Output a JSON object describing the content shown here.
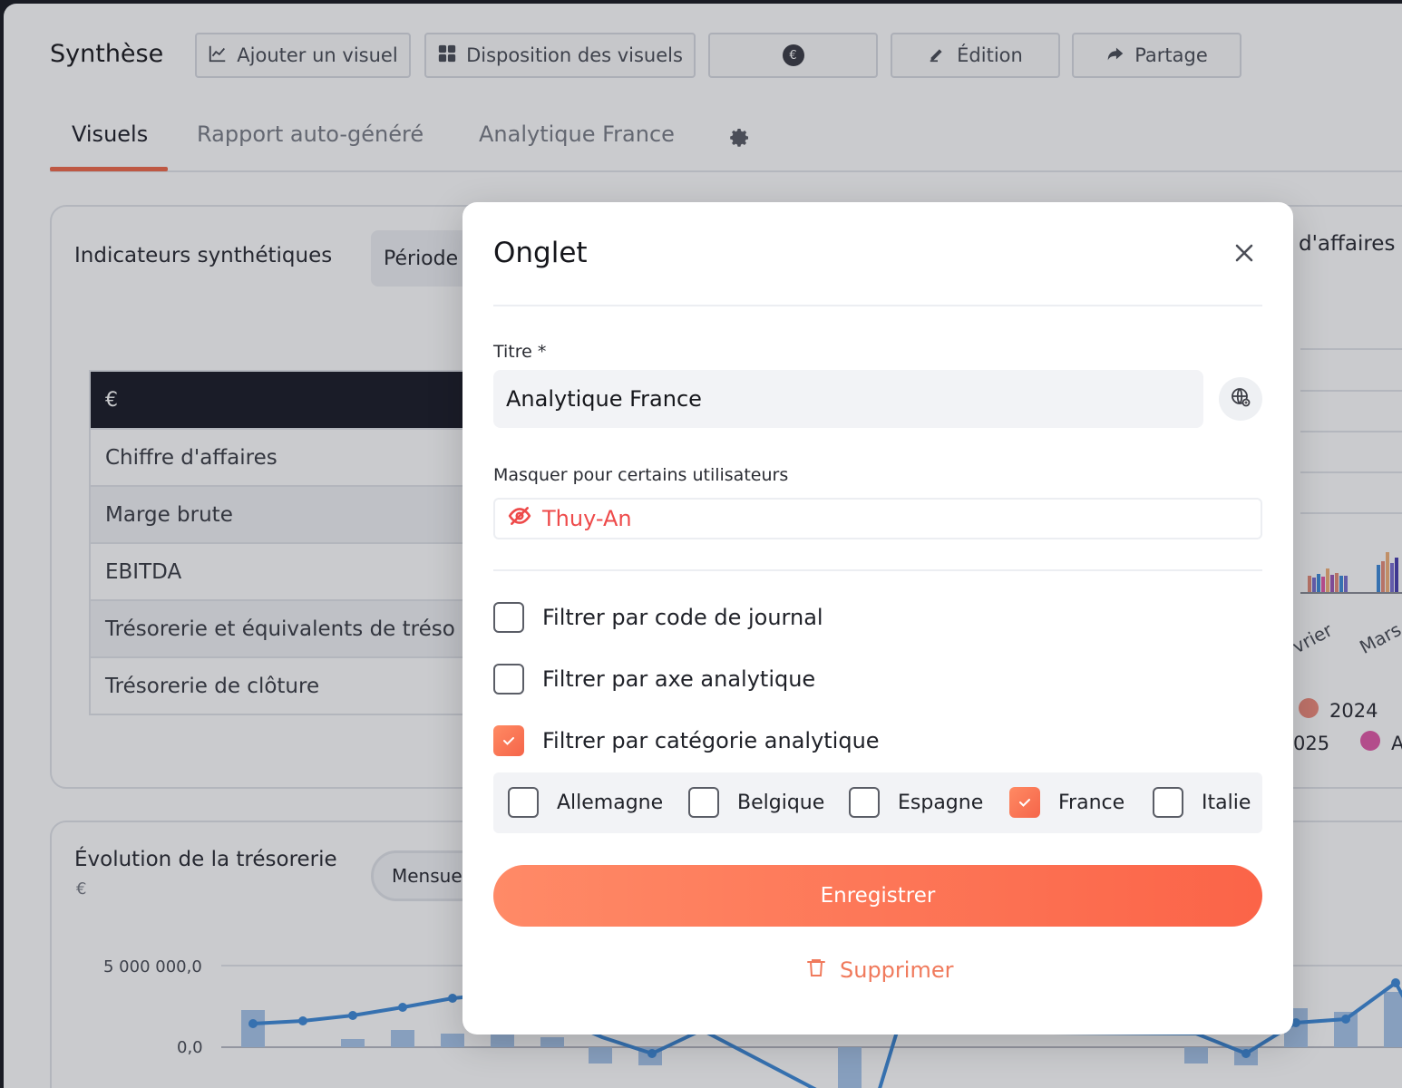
{
  "header": {
    "title": "Synthèse",
    "toolbar": {
      "add_visual": "Ajouter un visuel",
      "layout": "Disposition des visuels",
      "currency_icon": "€",
      "edit": "Édition",
      "share": "Partage"
    }
  },
  "tabs": [
    {
      "label": "Visuels",
      "active": true
    },
    {
      "label": "Rapport auto-généré",
      "active": false
    },
    {
      "label": "Analytique France",
      "active": false
    }
  ],
  "kpi_card": {
    "title": "Indicateurs synthétiques",
    "period_label": "Période",
    "table_header": "€",
    "rows": [
      "Chiffre d'affaires",
      "Marge brute",
      "EBITDA",
      "Trésorerie et équivalents de tréso",
      "Trésorerie de clôture"
    ]
  },
  "right_card": {
    "title_fragment": "d'affaires",
    "x_labels": [
      "vrier",
      "Mars"
    ],
    "legend": [
      "2024",
      "025",
      "A"
    ],
    "colors": {
      "legend_2024": "#f08c7c",
      "legend_a": "#e25aa8"
    }
  },
  "cash_card": {
    "title": "Évolution de la trésorerie",
    "unit": "€",
    "granularity": "Mensue",
    "y_ticks": [
      "5 000 000,0",
      "0,0"
    ]
  },
  "modal": {
    "title": "Onglet",
    "title_field_label": "Titre *",
    "title_field_value": "Analytique France",
    "hide_label": "Masquer pour certains utilisateurs",
    "hidden_user": "Thuy-An",
    "filters": [
      {
        "label": "Filtrer par code de journal",
        "checked": false
      },
      {
        "label": "Filtrer par axe analytique",
        "checked": false
      },
      {
        "label": "Filtrer par catégorie analytique",
        "checked": true
      }
    ],
    "categories": [
      {
        "label": "Allemagne",
        "checked": false
      },
      {
        "label": "Belgique",
        "checked": false
      },
      {
        "label": "Espagne",
        "checked": false
      },
      {
        "label": "France",
        "checked": true
      },
      {
        "label": "Italie",
        "checked": false
      }
    ],
    "save_label": "Enregistrer",
    "delete_label": "Supprimer"
  },
  "colors": {
    "accent": "#f5654a",
    "danger": "#ee4a4a",
    "chart_line": "#3f8ad8",
    "chart_bar": "#a8c6ea"
  }
}
